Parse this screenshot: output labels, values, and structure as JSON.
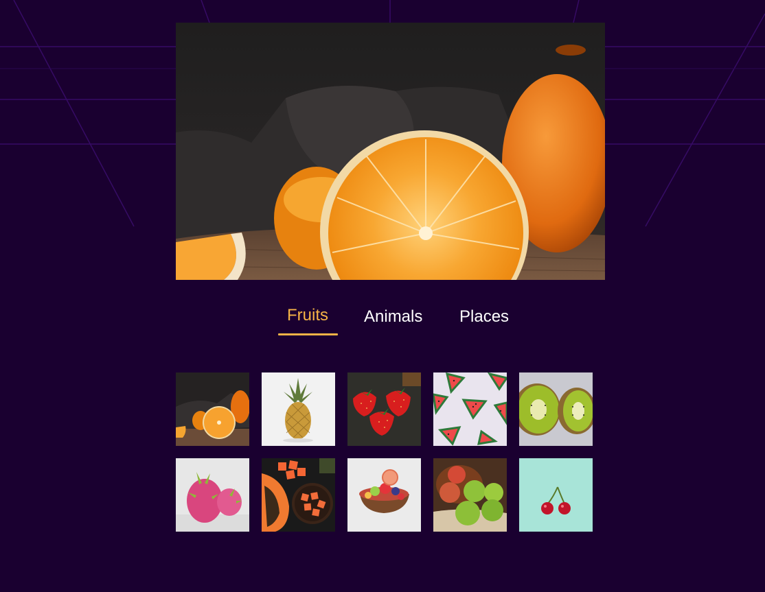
{
  "gallery": {
    "hero": {
      "subject": "halved-orange-photo",
      "icon": "orange-photo-icon"
    },
    "tabs": [
      {
        "label": "Fruits",
        "active": true
      },
      {
        "label": "Animals",
        "active": false
      },
      {
        "label": "Places",
        "active": false
      }
    ],
    "thumbnails": [
      {
        "subject": "oranges",
        "icon": "oranges-thumbnail-icon"
      },
      {
        "subject": "pineapple",
        "icon": "pineapple-thumbnail-icon"
      },
      {
        "subject": "strawberries",
        "icon": "strawberries-thumbnail-icon"
      },
      {
        "subject": "watermelon slices",
        "icon": "watermelon-thumbnail-icon"
      },
      {
        "subject": "kiwi",
        "icon": "kiwi-thumbnail-icon"
      },
      {
        "subject": "dragon fruit",
        "icon": "dragon-fruit-thumbnail-icon"
      },
      {
        "subject": "papaya",
        "icon": "papaya-thumbnail-icon"
      },
      {
        "subject": "fruit bowl",
        "icon": "fruit-bowl-thumbnail-icon"
      },
      {
        "subject": "apples",
        "icon": "apples-thumbnail-icon"
      },
      {
        "subject": "cherries",
        "icon": "cherries-thumbnail-icon"
      }
    ]
  },
  "colors": {
    "background": "#1a0030",
    "grid_lines": "#3a0d6b",
    "active_tab": "#f6b547",
    "tab_text": "#ffffff"
  }
}
